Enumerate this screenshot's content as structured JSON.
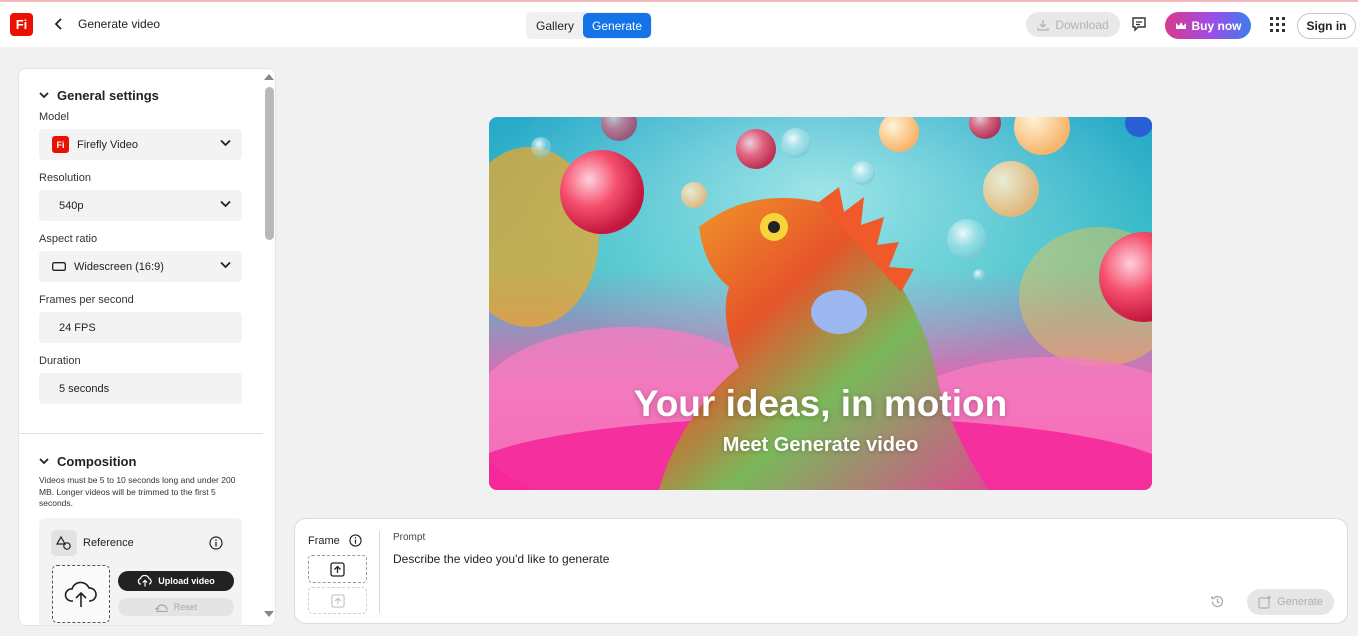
{
  "app": {
    "logo_text": "Fi",
    "page_title": "Generate video"
  },
  "header": {
    "tabs": [
      {
        "label": "Gallery",
        "active": false
      },
      {
        "label": "Generate",
        "active": true
      }
    ],
    "download_label": "Download",
    "buy_label": "Buy now",
    "signin_label": "Sign in"
  },
  "sidebar": {
    "general": {
      "title": "General settings",
      "model_label": "Model",
      "model_value": "Firefly Video",
      "model_icon_text": "Fi",
      "resolution_label": "Resolution",
      "resolution_value": "540p",
      "aspect_label": "Aspect ratio",
      "aspect_value": "Widescreen (16:9)",
      "fps_label": "Frames per second",
      "fps_value": "24 FPS",
      "duration_label": "Duration",
      "duration_value": "5 seconds"
    },
    "composition": {
      "title": "Composition",
      "note": "Videos must be 5 to 10 seconds long and under 200 MB. Longer videos will be trimmed to the first 5 seconds.",
      "reference_label": "Reference",
      "upload_label": "Upload video",
      "reset_label": "Reset"
    }
  },
  "hero": {
    "title": "Your ideas, in motion",
    "subtitle": "Meet Generate video"
  },
  "prompt": {
    "frame_label": "Frame",
    "prompt_label": "Prompt",
    "placeholder": "Describe the video you'd like to generate",
    "generate_label": "Generate"
  },
  "colors": {
    "accent_blue": "#1473e6",
    "brand_red": "#eb1000",
    "buy_gradient_start": "#d93a8c",
    "buy_gradient_end": "#3d7df0"
  }
}
